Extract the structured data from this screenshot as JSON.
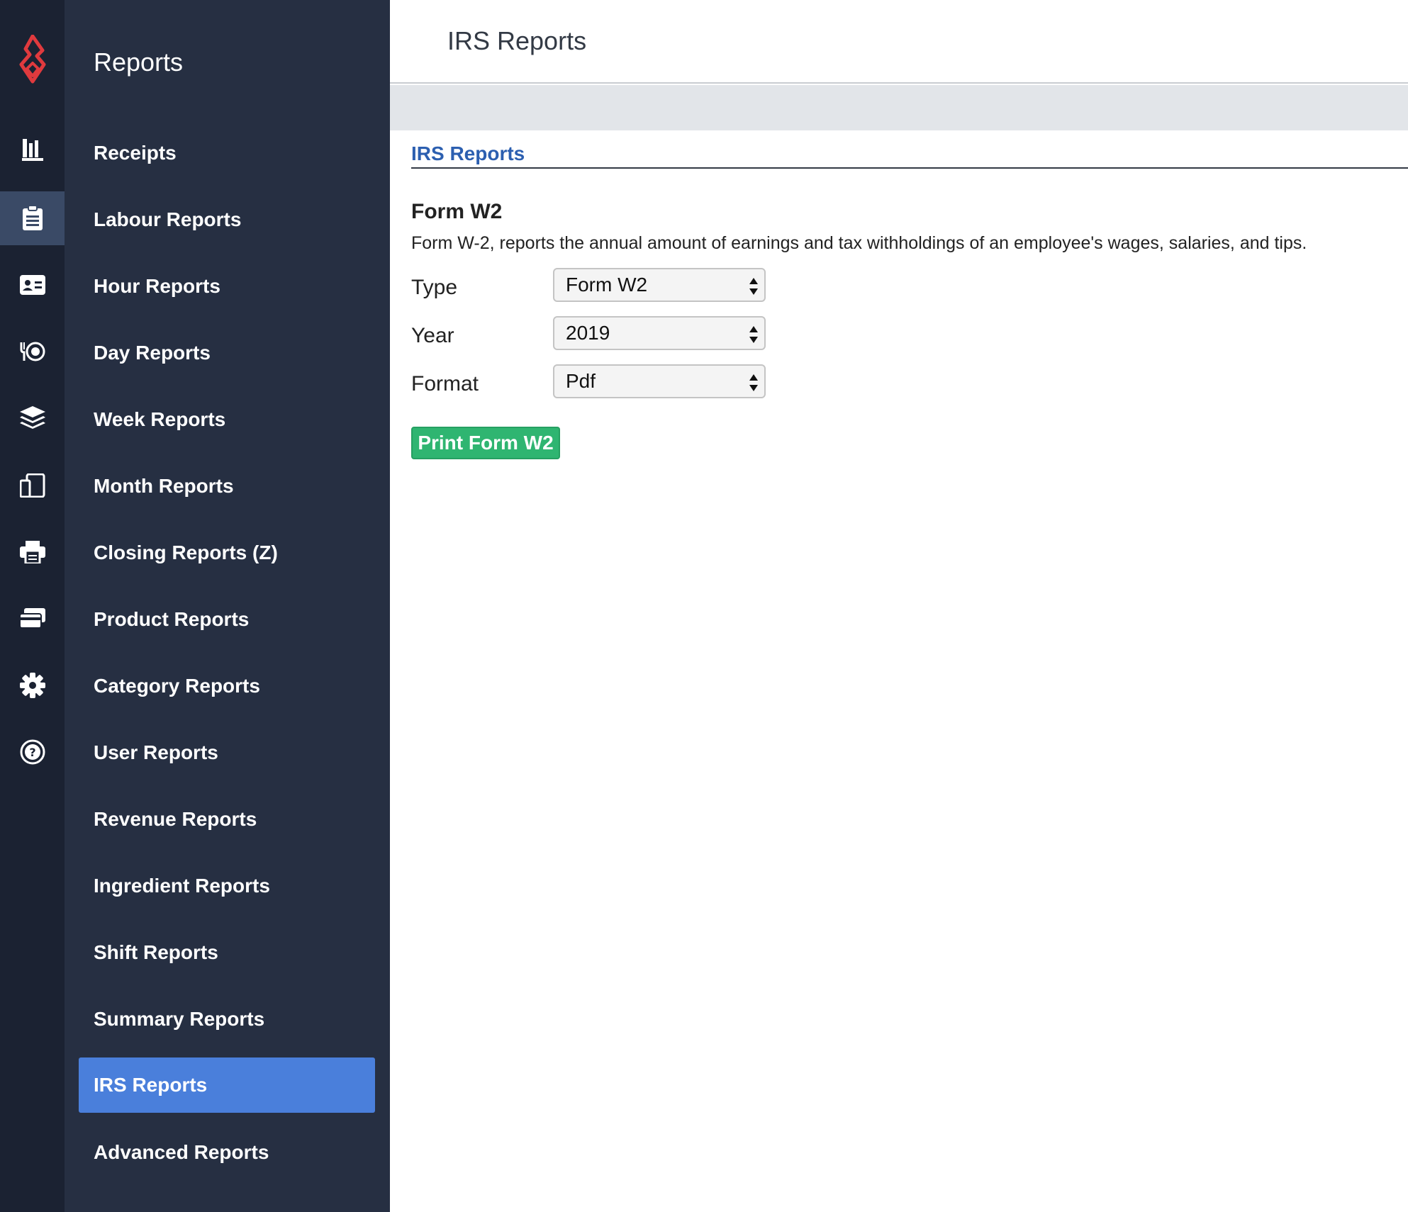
{
  "rail": {
    "icons": [
      {
        "name": "bar-chart-icon"
      },
      {
        "name": "clipboard-icon"
      },
      {
        "name": "id-card-icon"
      },
      {
        "name": "dining-icon"
      },
      {
        "name": "layers-icon"
      },
      {
        "name": "devices-icon"
      },
      {
        "name": "printer-icon"
      },
      {
        "name": "cards-icon"
      },
      {
        "name": "gear-icon"
      },
      {
        "name": "help-icon"
      }
    ],
    "active_index": 1
  },
  "sidebar": {
    "title": "Reports",
    "items": [
      {
        "label": "Receipts"
      },
      {
        "label": "Labour Reports"
      },
      {
        "label": "Hour Reports"
      },
      {
        "label": "Day Reports"
      },
      {
        "label": "Week Reports"
      },
      {
        "label": "Month Reports"
      },
      {
        "label": "Closing Reports (Z)"
      },
      {
        "label": "Product Reports"
      },
      {
        "label": "Category Reports"
      },
      {
        "label": "User Reports"
      },
      {
        "label": "Revenue Reports"
      },
      {
        "label": "Ingredient Reports"
      },
      {
        "label": "Shift Reports"
      },
      {
        "label": "Summary Reports"
      },
      {
        "label": "IRS Reports"
      },
      {
        "label": "Advanced Reports"
      }
    ],
    "active_label": "IRS Reports"
  },
  "header": {
    "title": "IRS Reports"
  },
  "main": {
    "section_title": "IRS Reports",
    "form_heading": "Form W2",
    "form_description": "Form W-2, reports the annual amount of earnings and tax withholdings of an employee's wages, salaries, and tips.",
    "fields": {
      "type": {
        "label": "Type",
        "value": "Form W2"
      },
      "year": {
        "label": "Year",
        "value": "2019"
      },
      "format": {
        "label": "Format",
        "value": "Pdf"
      }
    },
    "print_button": "Print Form W2"
  },
  "colors": {
    "rail_bg": "#1b2232",
    "sidebar_bg": "#262f42",
    "active_nav": "#4a7fdb",
    "brand_red": "#e03a3e",
    "link_blue": "#2c5fb0",
    "button_green": "#2fb571"
  }
}
